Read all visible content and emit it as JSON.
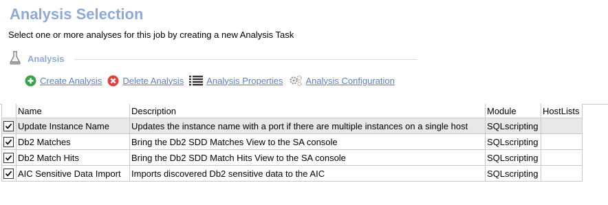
{
  "header": {
    "title": "Analysis Selection",
    "subtitle": "Select one or more analyses for this job by creating a new Analysis Task"
  },
  "section": {
    "label": "Analysis",
    "icon": "flask-icon"
  },
  "toolbar": {
    "create_label": "Create Analysis",
    "delete_label": "Delete Analysis",
    "properties_label": "Analysis Properties",
    "configuration_label": "Analysis Configuration"
  },
  "table": {
    "columns": [
      "Name",
      "Description",
      "Module",
      "HostLists"
    ],
    "rows": [
      {
        "checked": true,
        "name": "Update Instance Name",
        "description": "Updates the instance name with a port if there are multiple instances on a single host",
        "module": "SQLscripting",
        "hostlists": ""
      },
      {
        "checked": true,
        "name": "Db2 Matches",
        "description": "Bring the Db2 SDD Matches View to the SA console",
        "module": "SQLscripting",
        "hostlists": ""
      },
      {
        "checked": true,
        "name": "Db2 Match Hits",
        "description": "Bring the Db2 SDD Match Hits View to the SA console",
        "module": "SQLscripting",
        "hostlists": ""
      },
      {
        "checked": true,
        "name": "AIC Sensitive Data Import",
        "description": "Imports discovered Db2 sensitive data to the AIC",
        "module": "SQLscripting",
        "hostlists": ""
      }
    ]
  },
  "colors": {
    "title": "#8ea9d8",
    "link": "#5b7fc7",
    "create_icon": "#3aa34a",
    "delete_icon": "#e0413a"
  }
}
